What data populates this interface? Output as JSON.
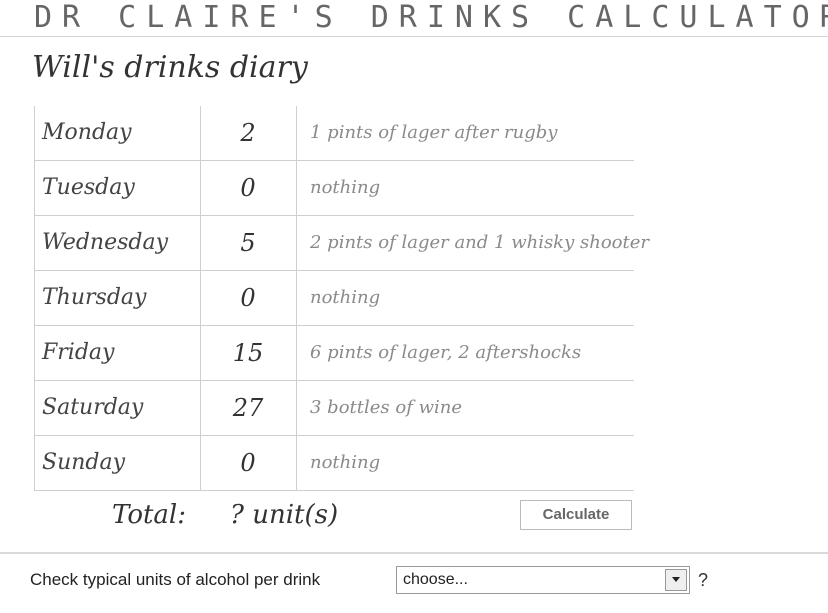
{
  "header": {
    "title": "DR CLAIRE'S DRINKS CALCULATOR"
  },
  "diary": {
    "title": "Will's drinks diary",
    "rows": [
      {
        "day": "Monday",
        "units": "2",
        "note": "1 pints of lager after rugby"
      },
      {
        "day": "Tuesday",
        "units": "0",
        "note": "nothing"
      },
      {
        "day": "Wednesday",
        "units": "5",
        "note": "2 pints of lager and 1 whisky shooter"
      },
      {
        "day": "Thursday",
        "units": "0",
        "note": "nothing"
      },
      {
        "day": "Friday",
        "units": "15",
        "note": "6 pints of lager, 2 aftershocks"
      },
      {
        "day": "Saturday",
        "units": "27",
        "note": "3 bottles of wine"
      },
      {
        "day": "Sunday",
        "units": "0",
        "note": "nothing"
      }
    ]
  },
  "total": {
    "label": "Total:",
    "value": "? unit(s)"
  },
  "calculate_button": {
    "label": "Calculate"
  },
  "footer": {
    "label": "Check typical units of alcohol per drink",
    "select_value": "choose...",
    "help": "?"
  }
}
